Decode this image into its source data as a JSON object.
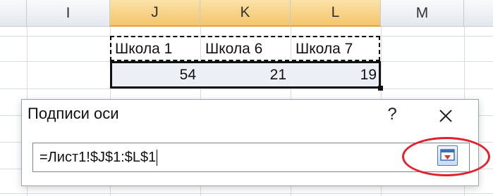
{
  "spreadsheet": {
    "columns": [
      "I",
      "J",
      "K",
      "L",
      "M"
    ],
    "selected_columns": [
      "J",
      "K",
      "L"
    ],
    "header_row": [
      "Школа 1",
      "Школа 6",
      "Школа 7"
    ],
    "value_row": [
      "54",
      "21",
      "19"
    ]
  },
  "dialog": {
    "title": "Подписи оси",
    "help_label": "?",
    "range_value": "=Лист1!$J$1:$L$1"
  },
  "colors": {
    "selected_header": "#f4c56c",
    "highlight_ring": "#e3202c",
    "range_fill": "#eceff5"
  },
  "icons": {
    "close": "close-icon",
    "collapse": "collapse-dialog-icon"
  }
}
